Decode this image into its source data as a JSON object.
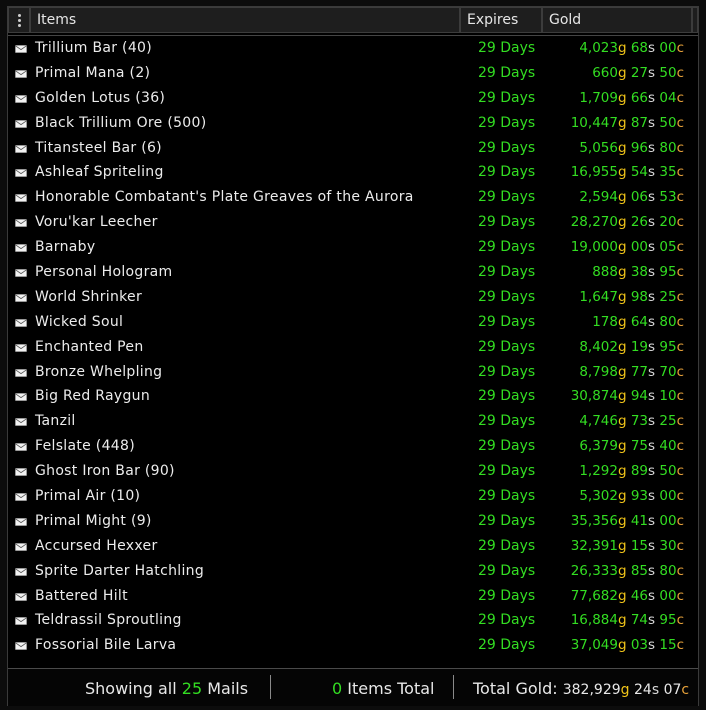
{
  "header": {
    "menu_icon": "vertical-ellipsis-icon",
    "items_label": "Items",
    "expires_label": "Expires",
    "gold_label": "Gold"
  },
  "item_icon": "envelope-icon",
  "colors": {
    "expires": "#33dd22",
    "gold_number": "#33dd22",
    "gold_unit": "#f0c419",
    "silver_unit": "#d8d8d8",
    "copper_unit": "#e8a23a"
  },
  "rows": [
    {
      "name": "Trillium Bar (40)",
      "expires": "29 Days",
      "g": "4,023",
      "s": "68",
      "c": "00"
    },
    {
      "name": "Primal Mana (2)",
      "expires": "29 Days",
      "g": "660",
      "s": "27",
      "c": "50"
    },
    {
      "name": "Golden Lotus (36)",
      "expires": "29 Days",
      "g": "1,709",
      "s": "66",
      "c": "04"
    },
    {
      "name": "Black Trillium Ore (500)",
      "expires": "29 Days",
      "g": "10,447",
      "s": "87",
      "c": "50"
    },
    {
      "name": "Titansteel Bar (6)",
      "expires": "29 Days",
      "g": "5,056",
      "s": "96",
      "c": "80"
    },
    {
      "name": "Ashleaf Spriteling",
      "expires": "29 Days",
      "g": "16,955",
      "s": "54",
      "c": "35"
    },
    {
      "name": "Honorable Combatant's Plate Greaves of the Aurora",
      "expires": "29 Days",
      "g": "2,594",
      "s": "06",
      "c": "53"
    },
    {
      "name": "Voru'kar Leecher",
      "expires": "29 Days",
      "g": "28,270",
      "s": "26",
      "c": "20"
    },
    {
      "name": "Barnaby",
      "expires": "29 Days",
      "g": "19,000",
      "s": "00",
      "c": "05"
    },
    {
      "name": "Personal Hologram",
      "expires": "29 Days",
      "g": "888",
      "s": "38",
      "c": "95"
    },
    {
      "name": "World Shrinker",
      "expires": "29 Days",
      "g": "1,647",
      "s": "98",
      "c": "25"
    },
    {
      "name": "Wicked Soul",
      "expires": "29 Days",
      "g": "178",
      "s": "64",
      "c": "80"
    },
    {
      "name": "Enchanted Pen",
      "expires": "29 Days",
      "g": "8,402",
      "s": "19",
      "c": "95"
    },
    {
      "name": "Bronze Whelpling",
      "expires": "29 Days",
      "g": "8,798",
      "s": "77",
      "c": "70"
    },
    {
      "name": "Big Red Raygun",
      "expires": "29 Days",
      "g": "30,874",
      "s": "94",
      "c": "10"
    },
    {
      "name": "Tanzil",
      "expires": "29 Days",
      "g": "4,746",
      "s": "73",
      "c": "25"
    },
    {
      "name": "Felslate (448)",
      "expires": "29 Days",
      "g": "6,379",
      "s": "75",
      "c": "40"
    },
    {
      "name": "Ghost Iron Bar (90)",
      "expires": "29 Days",
      "g": "1,292",
      "s": "89",
      "c": "50"
    },
    {
      "name": "Primal Air (10)",
      "expires": "29 Days",
      "g": "5,302",
      "s": "93",
      "c": "00"
    },
    {
      "name": "Primal Might (9)",
      "expires": "29 Days",
      "g": "35,356",
      "s": "41",
      "c": "00"
    },
    {
      "name": "Accursed Hexxer",
      "expires": "29 Days",
      "g": "32,391",
      "s": "15",
      "c": "30"
    },
    {
      "name": "Sprite Darter Hatchling",
      "expires": "29 Days",
      "g": "26,333",
      "s": "85",
      "c": "80"
    },
    {
      "name": "Battered Hilt",
      "expires": "29 Days",
      "g": "77,682",
      "s": "46",
      "c": "00"
    },
    {
      "name": "Teldrassil Sproutling",
      "expires": "29 Days",
      "g": "16,884",
      "s": "74",
      "c": "95"
    },
    {
      "name": "Fossorial Bile Larva",
      "expires": "29 Days",
      "g": "37,049",
      "s": "03",
      "c": "15"
    }
  ],
  "footer": {
    "showing_prefix": "Showing all",
    "mail_count": "25",
    "mails_label": "Mails",
    "items_count": "0",
    "items_label": "Items Total",
    "total_label": "Total Gold:",
    "total_g": "382,929",
    "total_s": "24",
    "total_c": "07"
  },
  "units": {
    "g": "g",
    "s": "s",
    "c": "c"
  }
}
